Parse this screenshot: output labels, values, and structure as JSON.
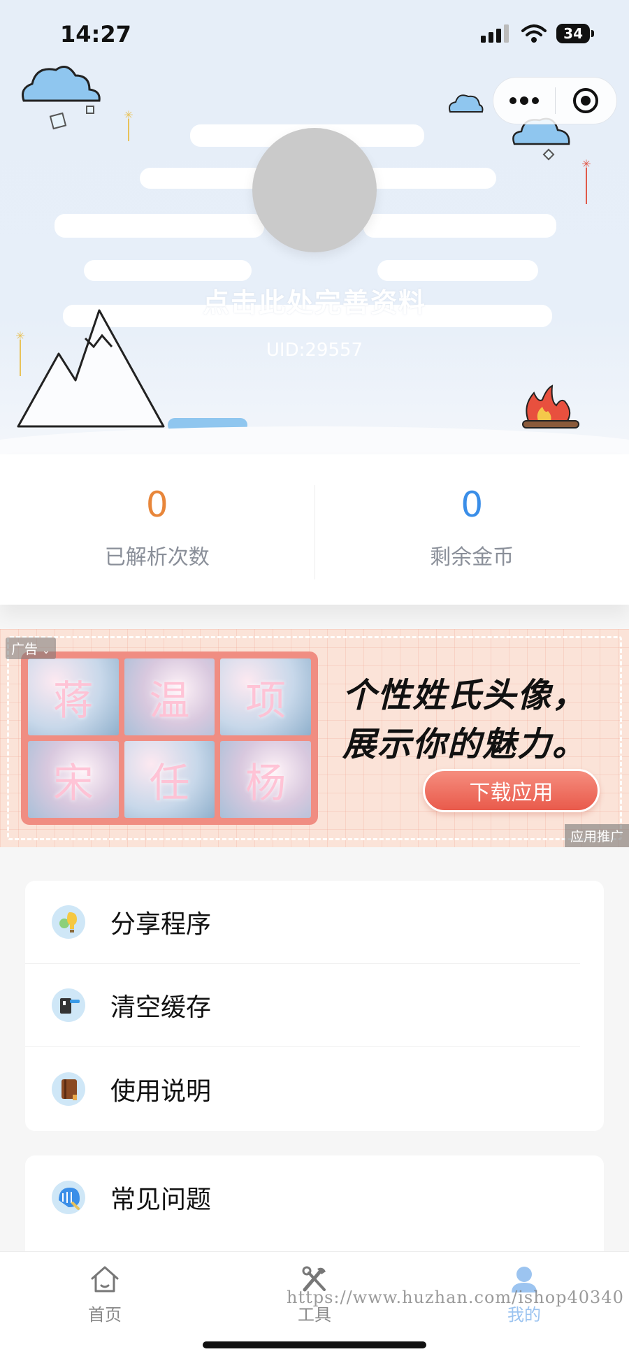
{
  "status_bar": {
    "time": "14:27",
    "battery": "34"
  },
  "profile": {
    "name_prompt": "点击此处完善资料",
    "uid": "UID:29557"
  },
  "stats": [
    {
      "value": "0",
      "label": "已解析次数",
      "color": "#e8863a"
    },
    {
      "value": "0",
      "label": "剩余金币",
      "color": "#3a8ee8"
    }
  ],
  "ad": {
    "tag": "广告",
    "promo_label": "应用推广",
    "headline_line1": "个性姓氏头像，",
    "headline_line2": "展示你的魅力。",
    "button_label": "下载应用",
    "tiles": [
      "蒋",
      "温",
      "项",
      "宋",
      "任",
      "杨"
    ]
  },
  "menu_primary": [
    {
      "label": "分享程序",
      "icon": "share-lightbulb-icon"
    },
    {
      "label": "清空缓存",
      "icon": "clear-cache-icon"
    },
    {
      "label": "使用说明",
      "icon": "manual-book-icon"
    }
  ],
  "menu_secondary": [
    {
      "label": "常见问题",
      "icon": "faq-icon"
    }
  ],
  "tabbar": [
    {
      "label": "首页",
      "icon": "home-icon",
      "active": false
    },
    {
      "label": "工具",
      "icon": "tools-icon",
      "active": false
    },
    {
      "label": "我的",
      "icon": "user-icon",
      "active": true
    }
  ],
  "watermark": "https://www.huzhan.com/ishop40340"
}
